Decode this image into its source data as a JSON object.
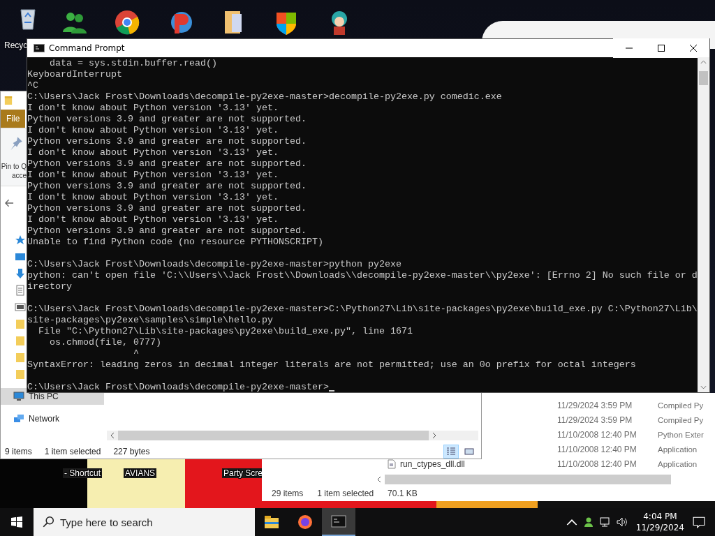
{
  "desktop": {
    "top_icons": [
      {
        "label": "Recyc"
      }
    ],
    "bottom_icons": [
      {
        "lines": [
          "- Shortcut"
        ]
      },
      {
        "lines": [
          "AVIANS"
        ]
      },
      {
        "lines": [
          "Party Scre"
        ]
      }
    ]
  },
  "explorer_left": {
    "file_tab": "File",
    "ribbon_lines": [
      "Pin to Q",
      "acce"
    ],
    "nav": [
      {
        "label": "This PC",
        "selected": true
      },
      {
        "label": "Network",
        "selected": false
      }
    ],
    "status": [
      "9 items",
      "1 item selected",
      "227 bytes"
    ],
    "views": [
      {
        "kind": "details",
        "selected": true
      },
      {
        "kind": "tiles",
        "selected": false
      }
    ]
  },
  "explorer_right": {
    "rows": [
      {
        "date": "11/29/2024 3:59 PM",
        "type": "Compiled Py"
      },
      {
        "date": "11/29/2024 3:59 PM",
        "type": "Compiled Py"
      },
      {
        "date": "11/10/2008 12:40 PM",
        "type": "Python Exter"
      },
      {
        "date": "11/10/2008 12:40 PM",
        "type": "Application"
      },
      {
        "name": "run_ctypes_dll.dll",
        "date": "11/10/2008 12:40 PM",
        "type": "Application"
      }
    ],
    "status": [
      "29 items",
      "1 item selected",
      "70.1 KB"
    ]
  },
  "console": {
    "title": "Command Prompt",
    "blocks": [
      [
        "    data = sys.stdin.buffer.read()",
        "KeyboardInterrupt",
        "^C",
        "C:\\Users\\Jack Frost\\Downloads\\decompile-py2exe-master>decompile-py2exe.py comedic.exe",
        "I don't know about Python version '3.13' yet.",
        "Python versions 3.9 and greater are not supported.",
        "I don't know about Python version '3.13' yet.",
        "Python versions 3.9 and greater are not supported.",
        "I don't know about Python version '3.13' yet.",
        "Python versions 3.9 and greater are not supported.",
        "I don't know about Python version '3.13' yet.",
        "Python versions 3.9 and greater are not supported.",
        "I don't know about Python version '3.13' yet.",
        "Python versions 3.9 and greater are not supported.",
        "I don't know about Python version '3.13' yet.",
        "Python versions 3.9 and greater are not supported.",
        "Unable to find Python code (no resource PYTHONSCRIPT)"
      ],
      [
        "C:\\Users\\Jack Frost\\Downloads\\decompile-py2exe-master>python py2exe",
        "python: can't open file 'C:\\\\Users\\\\Jack Frost\\\\Downloads\\\\decompile-py2exe-master\\\\py2exe': [Errno 2] No such file or d",
        "irectory"
      ],
      [
        "C:\\Users\\Jack Frost\\Downloads\\decompile-py2exe-master>C:\\Python27\\Lib\\site-packages\\py2exe\\build_exe.py C:\\Python27\\Lib\\",
        "site-packages\\py2exe\\samples\\simple\\hello.py",
        "  File \"C:\\Python27\\Lib\\site-packages\\py2exe\\build_exe.py\", line 1671",
        "    os.chmod(file, 0777)",
        "                   ^",
        "SyntaxError: leading zeros in decimal integer literals are not permitted; use an 0o prefix for octal integers"
      ],
      [
        "C:\\Users\\Jack Frost\\Downloads\\decompile-py2exe-master>"
      ]
    ]
  },
  "taskbar": {
    "search": {
      "placeholder": "Type here to search"
    },
    "apps": [
      {
        "kind": "explorer",
        "selected": false
      },
      {
        "kind": "firefox",
        "selected": false
      },
      {
        "kind": "terminal",
        "selected": true
      }
    ],
    "clock": {
      "time": "4:04 PM",
      "date": "11/29/2024"
    }
  }
}
